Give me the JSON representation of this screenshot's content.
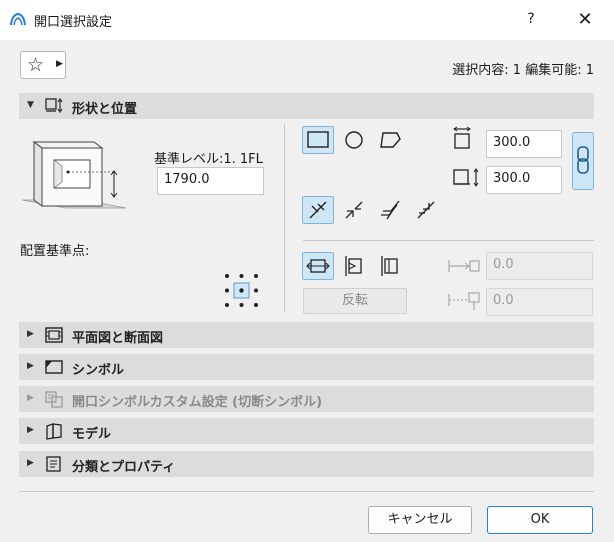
{
  "window": {
    "title": "開口選択設定",
    "help_label": "?",
    "close_label": "✕"
  },
  "toolbar": {
    "favorites_icon": "star-icon",
    "selection_info": "選択内容: 1 編集可能: 1"
  },
  "shape_section": {
    "label": "形状と位置",
    "base_level_label": "基準レベル:1. 1FL",
    "base_level_value": "1790.0",
    "anchor_label": "配置基準点:",
    "width_value": "300.0",
    "height_value": "300.0",
    "offset1_value": "0.0",
    "offset2_value": "0.0",
    "flip_label": "反転"
  },
  "sections": [
    {
      "label": "平面図と断面図",
      "icon": "floor-plan-icon",
      "disabled": false
    },
    {
      "label": "シンボル",
      "icon": "symbol-icon",
      "disabled": false
    },
    {
      "label": "開口シンボルカスタム設定 (切断シンボル)",
      "icon": "custom-symbol-icon",
      "disabled": true
    },
    {
      "label": "モデル",
      "icon": "model-icon",
      "disabled": false
    },
    {
      "label": "分類とプロパティ",
      "icon": "classification-icon",
      "disabled": false
    }
  ],
  "footer": {
    "cancel_label": "キャンセル",
    "ok_label": "OK"
  },
  "colors": {
    "accent": "#2f7bd4",
    "active_bg": "#cfe6f7",
    "section_bg": "#dcdcdc"
  }
}
